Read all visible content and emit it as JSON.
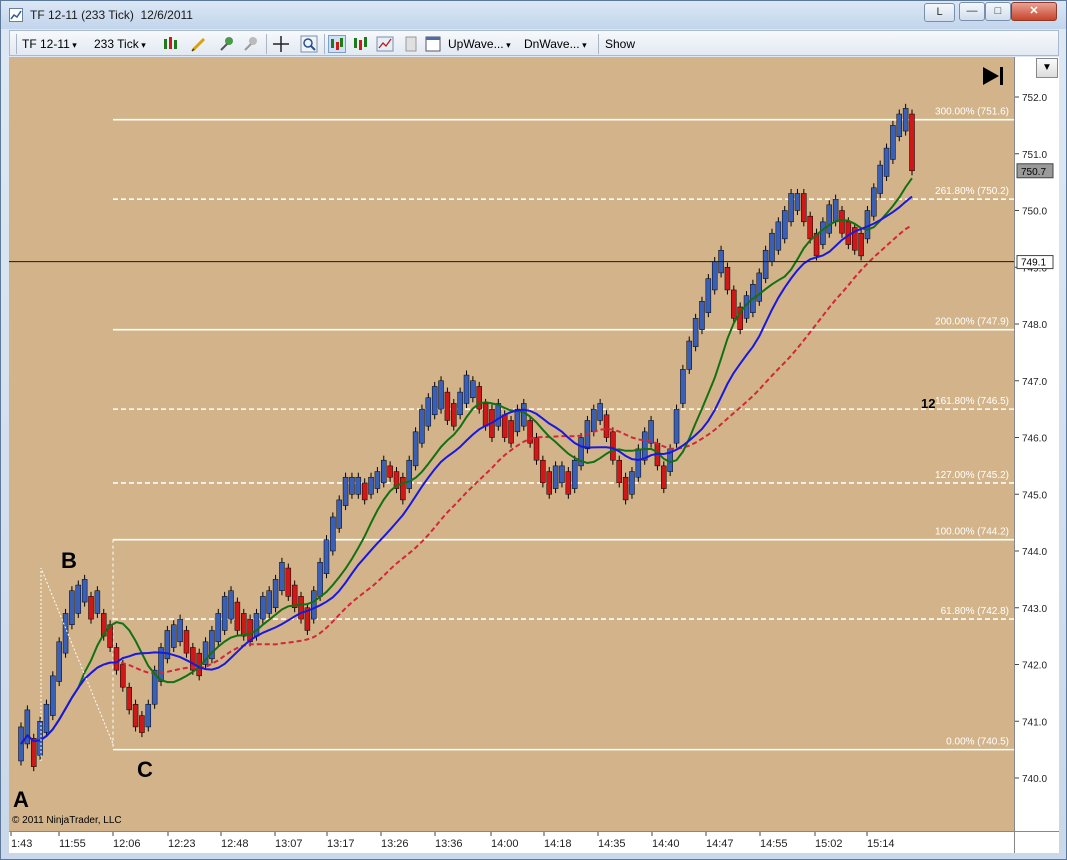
{
  "window": {
    "title": "TF 12-11 (233 Tick)  12/6/2011",
    "buttons": {
      "l": "L",
      "minimize": "—",
      "maximize": "□",
      "close": "✕"
    }
  },
  "toolbar": {
    "instrument": "TF 12-11",
    "interval": "233 Tick",
    "upwave": "UpWave...",
    "dnwave": "DnWave...",
    "show": "Show"
  },
  "chart": {
    "copyright": "© 2011 NinjaTrader, LLC",
    "points": {
      "a": "A",
      "b": "B",
      "c": "C"
    },
    "bar_countdown": "12",
    "current_price": "750.7",
    "cursor_price": "749.1",
    "colors": {
      "background": "#d3b48a",
      "up_candle": "#3a5fb6",
      "down_candle": "#d01818",
      "fast_ma": "#1818e0",
      "mid_ma": "#137013",
      "slow_ma": "#d0283a",
      "level": "#ffffff"
    },
    "fib_levels": [
      {
        "label": "300.00% (751.6)",
        "price": 751.6,
        "style": "solid"
      },
      {
        "label": "261.80% (750.2)",
        "price": 750.2,
        "style": "dashed"
      },
      {
        "label": "200.00% (747.9)",
        "price": 747.9,
        "style": "solid"
      },
      {
        "label": "161.80% (746.5)",
        "price": 746.5,
        "style": "dashed"
      },
      {
        "label": "127.00% (745.2)",
        "price": 745.2,
        "style": "dashed"
      },
      {
        "label": "100.00% (744.2)",
        "price": 744.2,
        "style": "solid"
      },
      {
        "label": "61.80% (742.8)",
        "price": 742.8,
        "style": "dashed"
      },
      {
        "label": "0.00% (740.5)",
        "price": 740.5,
        "style": "solid"
      }
    ],
    "price_ticks": [
      "752.0",
      "751.0",
      "750.0",
      "749.0",
      "748.0",
      "747.0",
      "746.0",
      "745.0",
      "744.0",
      "743.0",
      "742.0",
      "741.0",
      "740.0"
    ],
    "time_ticks": [
      "1:43",
      "11:55",
      "12:06",
      "12:23",
      "12:48",
      "13:07",
      "13:17",
      "13:26",
      "13:36",
      "14:00",
      "14:18",
      "14:35",
      "14:40",
      "14:47",
      "14:55",
      "15:02",
      "15:14"
    ]
  }
}
